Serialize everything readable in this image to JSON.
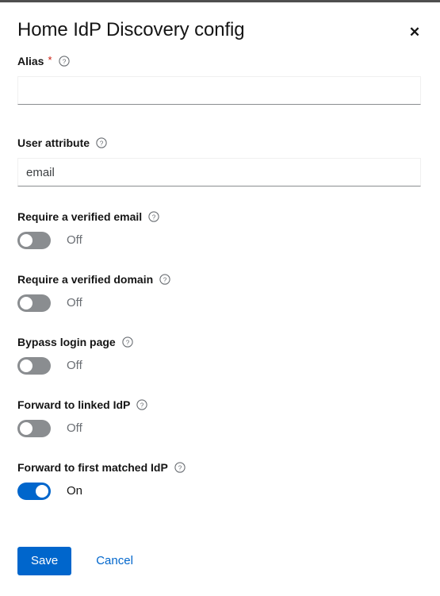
{
  "top_strip": {
    "color": "#4f4f4f"
  },
  "colors": {
    "accent_blue": "#0066cc",
    "switch_off_grey": "#8a8d90",
    "required_red": "#c9190b",
    "text_primary": "#151515",
    "text_muted": "#6a6e73"
  },
  "modal": {
    "title": "Home IdP Discovery config",
    "close_label": "✕"
  },
  "fields": {
    "alias": {
      "label": "Alias",
      "required_marker": "*",
      "help_icon": "help-circle-icon",
      "value": "",
      "placeholder": ""
    },
    "user_attribute": {
      "label": "User attribute",
      "help_icon": "help-circle-icon",
      "value": "email",
      "placeholder": "email"
    }
  },
  "switches": [
    {
      "key": "require-verified-email",
      "label": "Require a verified email",
      "help_icon": "help-circle-icon",
      "state_label": "Off",
      "on": false
    },
    {
      "key": "require-verified-domain",
      "label": "Require a verified domain",
      "help_icon": "help-circle-icon",
      "state_label": "Off",
      "on": false
    },
    {
      "key": "bypass-login-page",
      "label": "Bypass login page",
      "help_icon": "help-circle-icon",
      "state_label": "Off",
      "on": false
    },
    {
      "key": "forward-to-linked-idp",
      "label": "Forward to linked IdP",
      "help_icon": "help-circle-icon",
      "state_label": "Off",
      "on": false
    },
    {
      "key": "forward-to-first-matched-idp",
      "label": "Forward to first matched IdP",
      "help_icon": "help-circle-icon",
      "state_label": "On",
      "on": true
    }
  ],
  "footer": {
    "save_label": "Save",
    "cancel_label": "Cancel"
  }
}
